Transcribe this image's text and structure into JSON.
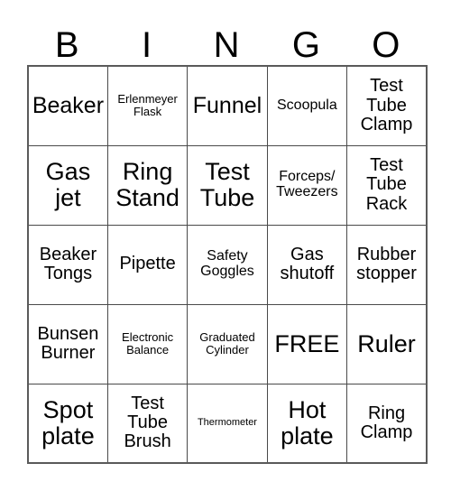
{
  "card": {
    "title": "BINGO",
    "header_letters": [
      "B",
      "I",
      "N",
      "G",
      "O"
    ],
    "free_space_label": "FREE",
    "colors": {
      "background": "#ffffff",
      "text": "#000000",
      "grid_line": "#4a4a4a",
      "outer_border": "#5a5a5a"
    },
    "rows": [
      [
        {
          "text": "Beaker",
          "size": "sz-lg"
        },
        {
          "text": "Erlenmeyer\nFlask",
          "size": "sz-xs"
        },
        {
          "text": "Funnel",
          "size": "sz-lg"
        },
        {
          "text": "Scoopula",
          "size": "sz-sm"
        },
        {
          "text": "Test\nTube\nClamp",
          "size": "sz-md"
        }
      ],
      [
        {
          "text": "Gas\njet",
          "size": "sz-xl"
        },
        {
          "text": "Ring\nStand",
          "size": "sz-xl"
        },
        {
          "text": "Test\nTube",
          "size": "sz-xl"
        },
        {
          "text": "Forceps/\nTweezers",
          "size": "sz-sm"
        },
        {
          "text": "Test\nTube\nRack",
          "size": "sz-md"
        }
      ],
      [
        {
          "text": "Beaker\nTongs",
          "size": "sz-md"
        },
        {
          "text": "Pipette",
          "size": "sz-md"
        },
        {
          "text": "Safety\nGoggles",
          "size": "sz-sm"
        },
        {
          "text": "Gas\nshutoff",
          "size": "sz-md"
        },
        {
          "text": "Rubber\nstopper",
          "size": "sz-md"
        }
      ],
      [
        {
          "text": "Bunsen\nBurner",
          "size": "sz-md"
        },
        {
          "text": "Electronic\nBalance",
          "size": "sz-xs"
        },
        {
          "text": "Graduated\nCylinder",
          "size": "sz-xs"
        },
        {
          "text": "FREE",
          "size": "sz-xl"
        },
        {
          "text": "Ruler",
          "size": "sz-xl"
        }
      ],
      [
        {
          "text": "Spot\nplate",
          "size": "sz-xl"
        },
        {
          "text": "Test\nTube\nBrush",
          "size": "sz-md"
        },
        {
          "text": "Thermometer",
          "size": "sz-xxs"
        },
        {
          "text": "Hot\nplate",
          "size": "sz-xl"
        },
        {
          "text": "Ring\nClamp",
          "size": "sz-md"
        }
      ]
    ]
  }
}
